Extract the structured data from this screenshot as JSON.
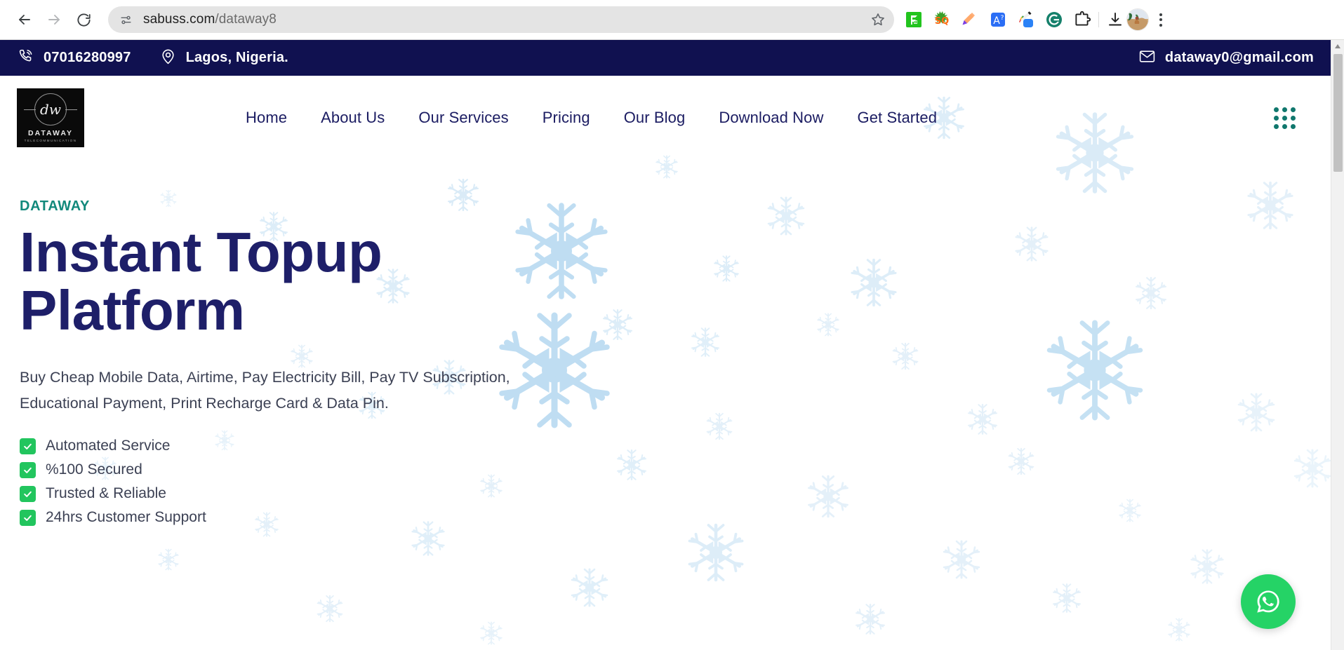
{
  "browser": {
    "back_label": "Back",
    "forward_label": "Forward",
    "reload_label": "Reload",
    "site_info_label": "site-info",
    "url_host": "sabuss.com",
    "url_path": "/dataway8",
    "bookmark_label": "Bookmark this tab",
    "extensions": [
      {
        "name": "formatter-extension-icon",
        "label": "F"
      },
      {
        "name": "seoquake-extension-icon",
        "label": "SQ"
      },
      {
        "name": "highlighter-extension-icon",
        "label": ""
      },
      {
        "name": "translate-extension-icon",
        "label": "A?"
      },
      {
        "name": "colorpicker-extension-icon",
        "label": ""
      },
      {
        "name": "grammarly-extension-icon",
        "label": "G"
      },
      {
        "name": "extensions-puzzle-icon",
        "label": ""
      }
    ],
    "download_label": "Downloads",
    "profile_label": "Profile",
    "menu_label": "Customize and control Google Chrome"
  },
  "topbar": {
    "phone": "07016280997",
    "location": "Lagos, Nigeria.",
    "email": "dataway0@gmail.com",
    "background": "#101150"
  },
  "header": {
    "logo": {
      "monogram": "dw",
      "name": "DATAWAY",
      "subtitle": "TELECOMMUNICATION"
    },
    "nav": [
      {
        "label": "Home"
      },
      {
        "label": "About Us"
      },
      {
        "label": "Our Services"
      },
      {
        "label": "Pricing"
      },
      {
        "label": "Our Blog"
      },
      {
        "label": "Download Now"
      },
      {
        "label": "Get Started"
      }
    ],
    "grid_menu_label": "Apps",
    "nav_color": "#1b1c62",
    "grid_color": "#10776d"
  },
  "hero": {
    "eyebrow": "DATAWAY",
    "title_line1": "Instant Topup",
    "title_line2": "Platform",
    "description": "Buy Cheap Mobile Data, Airtime, Pay Electricity Bill, Pay TV Subscription, Educational Payment, Print Recharge Card & Data Pin.",
    "features": [
      {
        "label": "Automated Service"
      },
      {
        "label": "%100 Secured"
      },
      {
        "label": "Trusted & Reliable"
      },
      {
        "label": "24hrs Customer Support"
      }
    ],
    "title_color": "#1e1f69",
    "eyebrow_color": "#12897c",
    "check_color": "#22c55e"
  },
  "floating": {
    "whatsapp_label": "Chat on WhatsApp",
    "whatsapp_color": "#25d366"
  },
  "decoration": {
    "snowflake_color": "#bcdcf2",
    "snowflake_label": "snowflake"
  }
}
